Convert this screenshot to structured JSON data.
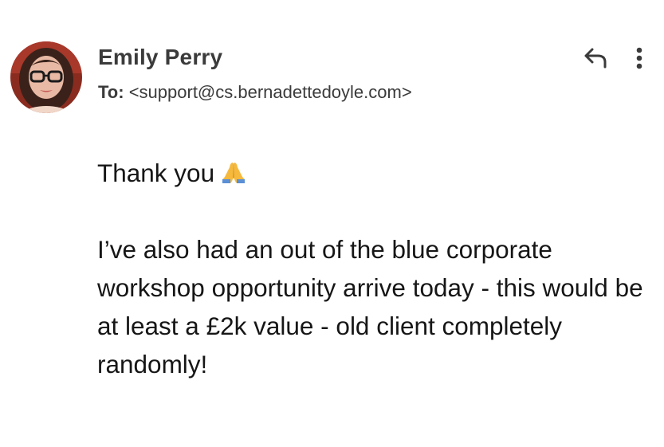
{
  "sender": {
    "name": "Emily Perry",
    "avatar_icon": "profile-photo"
  },
  "recipient": {
    "label": "To:",
    "address": "<support@cs.bernadettedoyle.com>"
  },
  "actions": {
    "reply_icon": "reply-arrow-icon",
    "more_icon": "vertical-dots-icon"
  },
  "message": {
    "line1": "Thank you",
    "line1_emoji": "folded-hands-emoji",
    "paragraph2": "I’ve also had an out of the blue corporate workshop opportunity arrive today - this would be at least a £2k value - old client completely randomly!"
  },
  "colors": {
    "header_text": "#3b3b3b",
    "body_text": "#161616",
    "background": "#ffffff"
  }
}
